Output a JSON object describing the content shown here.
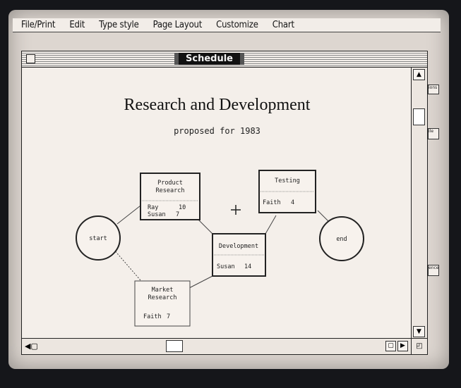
{
  "menu": [
    "File/Print",
    "Edit",
    "Type style",
    "Page Layout",
    "Customize",
    "Chart"
  ],
  "window": {
    "title": "Schedule"
  },
  "document": {
    "title": "Research and Development",
    "subtitle": "proposed for 1983"
  },
  "nodes": {
    "start": "start",
    "end": "end",
    "product_research": {
      "title_line1": "Product",
      "title_line2": "Research",
      "rows": [
        [
          "Ray",
          "10"
        ],
        [
          "Susan",
          "7"
        ]
      ]
    },
    "market_research": {
      "title_line1": "Market",
      "title_line2": "Research",
      "rows": [
        [
          "Faith",
          "7"
        ]
      ]
    },
    "development": {
      "title": "Development",
      "rows": [
        [
          "Susan",
          "14"
        ]
      ]
    },
    "testing": {
      "title": "Testing",
      "rows": [
        [
          "Faith",
          "4"
        ]
      ]
    }
  },
  "side_tabs": [
    "ions",
    "ile",
    "ences"
  ],
  "colors": {
    "screen": "#ddd6d0",
    "window": "#f4efea",
    "ink": "#222222"
  }
}
